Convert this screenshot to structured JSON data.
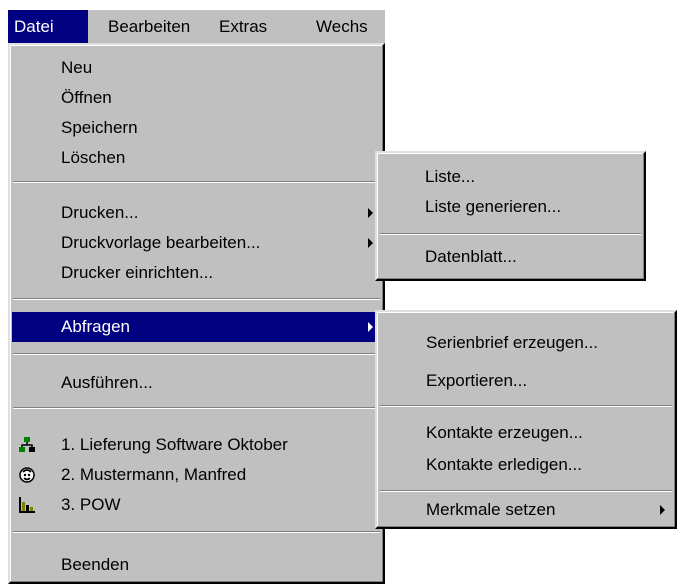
{
  "menubar": {
    "items": [
      {
        "label": "Datei",
        "active": true
      },
      {
        "label": "Bearbeiten",
        "active": false
      },
      {
        "label": "Extras",
        "active": false
      },
      {
        "label": "Wechs",
        "active": false
      }
    ]
  },
  "file_menu": {
    "items": [
      {
        "label": "Neu"
      },
      {
        "label": "Öffnen"
      },
      {
        "label": "Speichern"
      },
      {
        "label": "Löschen"
      },
      {
        "label": "Drucken...",
        "submenu": true
      },
      {
        "label": "Druckvorlage bearbeiten...",
        "submenu": true
      },
      {
        "label": "Drucker einrichten..."
      },
      {
        "label": "Abfragen",
        "submenu": true,
        "highlighted": true
      },
      {
        "label": "Ausführen..."
      },
      {
        "label": "1. Lieferung Software Oktober",
        "icon": "network-icon"
      },
      {
        "label": "2. Mustermann, Manfred",
        "icon": "person-icon"
      },
      {
        "label": "3. POW",
        "icon": "chart-icon"
      },
      {
        "label": "Beenden"
      }
    ]
  },
  "print_submenu": {
    "items": [
      {
        "label": "Liste..."
      },
      {
        "label": "Liste generieren..."
      },
      {
        "label": "Datenblatt..."
      }
    ]
  },
  "queries_submenu": {
    "items": [
      {
        "label": "Serienbrief erzeugen..."
      },
      {
        "label": "Exportieren..."
      },
      {
        "label": "Kontakte erzeugen..."
      },
      {
        "label": "Kontakte erledigen..."
      },
      {
        "label": "Merkmale setzen",
        "submenu": true
      }
    ]
  },
  "colors": {
    "menu_bg": "#c0c0c0",
    "highlight": "#000080",
    "highlight_text": "#ffffff"
  }
}
